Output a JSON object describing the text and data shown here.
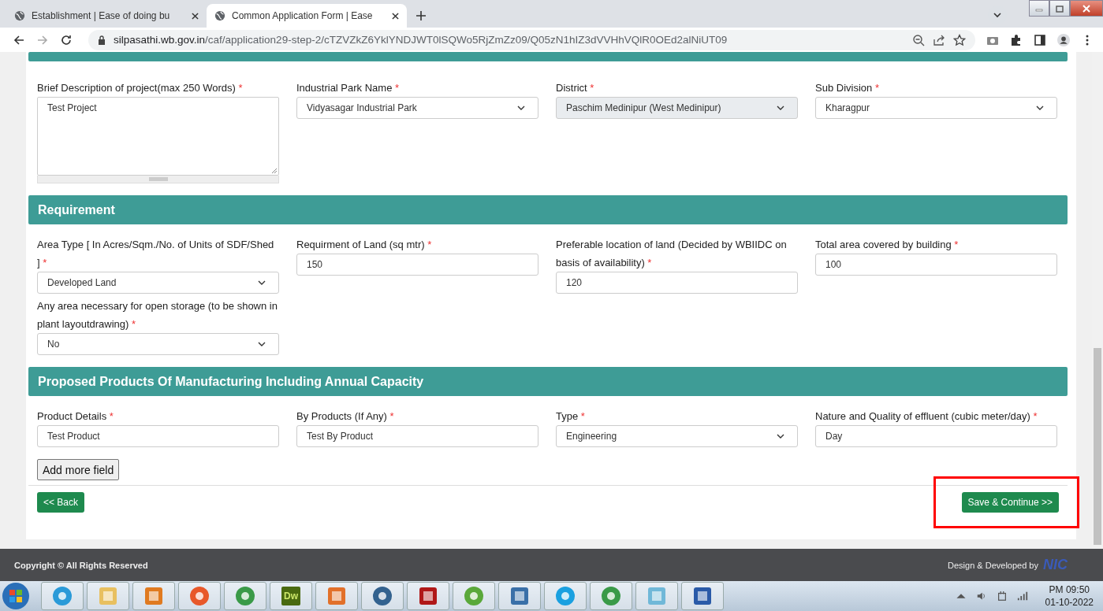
{
  "browser": {
    "tabs": [
      {
        "title": "Establishment | Ease of doing bu",
        "selected": false
      },
      {
        "title": "Common Application Form | Ease",
        "selected": true
      }
    ],
    "url": {
      "host": "silpasathi.wb.gov.in",
      "path": "/caf/application29-step-2/cTZVZkZ6YklYNDJWT0lSQWo5RjZmZz09/Q05zN1hIZ3dVVHhVQlR0OEd2alNiUT09"
    }
  },
  "sections": [
    {
      "fields": [
        {
          "label": "Brief Description of project(max 250 Words)",
          "mark": "*",
          "kind": "textarea",
          "value": "Test Project"
        },
        {
          "label": "Industrial Park Name",
          "mark": "*",
          "kind": "select",
          "value": "Vidyasagar Industrial Park",
          "disabled": false
        },
        {
          "label": "District",
          "mark": "*",
          "kind": "select",
          "value": "Paschim Medinipur (West Medinipur)",
          "disabled": true
        },
        {
          "label": "Sub Division",
          "mark": "*",
          "kind": "select",
          "value": "Kharagpur",
          "disabled": false
        }
      ]
    },
    {
      "title": "Requirement",
      "fields": [
        {
          "label": "Area Type [ In Acres/Sqm./No. of Units of SDF/Shed ]",
          "mark": "*",
          "kind": "select",
          "value": "Developed Land",
          "disabled": false
        },
        {
          "label": "Requirment of Land (sq mtr)",
          "mark": "*",
          "kind": "input",
          "value": "150"
        },
        {
          "label": "Preferable location of land (Decided by WBIIDC on basis of availability)",
          "mark": "*",
          "kind": "input",
          "value": "120"
        },
        {
          "label": "Total area covered by building",
          "mark": "*",
          "kind": "input",
          "value": "100"
        },
        {
          "label": "Any area necessary for open storage (to be shown in plant layoutdrawing)",
          "mark": "*",
          "kind": "select",
          "value": "No",
          "disabled": false
        }
      ]
    },
    {
      "title": "Proposed Products Of Manufacturing Including Annual Capacity",
      "fields": [
        {
          "label": "Product Details",
          "mark": "*",
          "kind": "input",
          "value": "Test Product"
        },
        {
          "label": "By Products (If Any)",
          "mark": "*",
          "kind": "input",
          "value": "Test By Product"
        },
        {
          "label": "Type",
          "mark": "*",
          "kind": "select",
          "value": "Engineering",
          "disabled": false
        },
        {
          "label": "Nature and Quality of effluent (cubic meter/day)",
          "mark": "*",
          "kind": "input",
          "value": "Day"
        }
      ],
      "add_button": "Add more field"
    }
  ],
  "actions": {
    "back": "<< Back",
    "save": {
      "label": "Save & Continue >>",
      "highlighted": true
    }
  },
  "footer": {
    "copyright": "Copyright © All Rights Reserved",
    "credit": "Design & Developed by",
    "logo": "NIC"
  },
  "taskbar": {
    "apps": [
      {
        "kind": "ie"
      },
      {
        "kind": "folder"
      },
      {
        "kind": "media"
      },
      {
        "kind": "firefox"
      },
      {
        "kind": "chrome"
      },
      {
        "kind": "dw",
        "label": "Dw"
      },
      {
        "kind": "xampp"
      },
      {
        "kind": "postgres"
      },
      {
        "kind": "filezilla"
      },
      {
        "kind": "utorrent"
      },
      {
        "kind": "python"
      },
      {
        "kind": "skype"
      },
      {
        "kind": "chrome"
      },
      {
        "kind": "notepad"
      },
      {
        "kind": "word"
      }
    ],
    "time": "PM 09:50",
    "date": "01-10-2022"
  }
}
